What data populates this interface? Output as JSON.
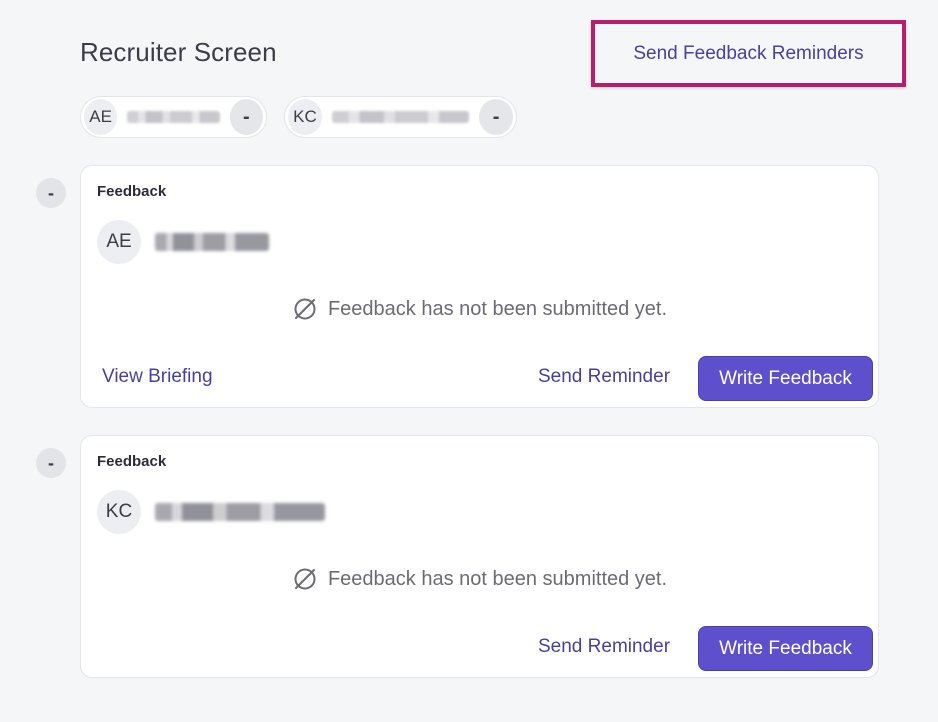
{
  "header": {
    "title": "Recruiter Screen",
    "send_reminders_label": "Send Feedback Reminders"
  },
  "interviewers": [
    {
      "initials": "AE",
      "remove_label": "-"
    },
    {
      "initials": "KC",
      "remove_label": "-"
    }
  ],
  "cards": [
    {
      "collapse_label": "-",
      "label": "Feedback",
      "initials": "AE",
      "status": "Feedback has not been submitted yet.",
      "view_briefing": "View Briefing",
      "send_reminder": "Send Reminder",
      "write_feedback": "Write Feedback"
    },
    {
      "collapse_label": "-",
      "label": "Feedback",
      "initials": "KC",
      "status": "Feedback has not been submitted yet.",
      "send_reminder": "Send Reminder",
      "write_feedback": "Write Feedback"
    }
  ],
  "colors": {
    "accent": "#5e4fcc",
    "link": "#4a3f9e",
    "highlight_border": "#b51f6e",
    "background": "#f4f6f8"
  },
  "icons": [
    "remove-icon",
    "collapse-icon",
    "not-submitted-icon"
  ]
}
